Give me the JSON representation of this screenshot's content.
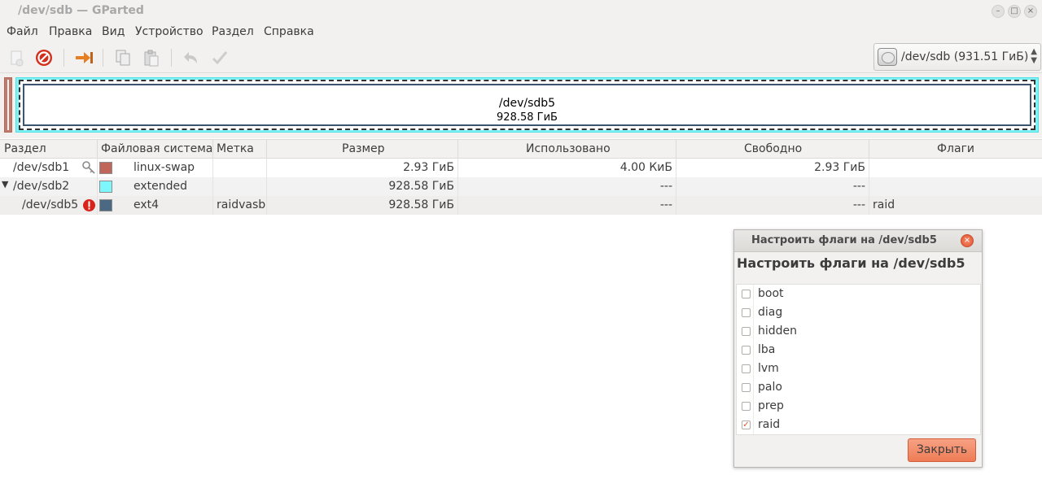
{
  "window": {
    "title": "/dev/sdb — GParted"
  },
  "menu": [
    "Файл",
    "Правка",
    "Вид",
    "Устройство",
    "Раздел",
    "Справка"
  ],
  "toolbar": {
    "icons": [
      "new-icon",
      "delete-icon",
      "resize-move-icon",
      "copy-icon",
      "paste-icon",
      "undo-icon",
      "apply-icon"
    ]
  },
  "device_selector": {
    "label": "/dev/sdb  (931.51 ГиБ)"
  },
  "disk_graph": {
    "name": "/dev/sdb5",
    "size": "928.58 ГиБ"
  },
  "colors": {
    "linux_swap": "#c1665a",
    "extended": "#7df7fc",
    "ext4": "#4b6983",
    "accent": "#ef7c55"
  },
  "table": {
    "headers": [
      "Раздел",
      "Файловая система",
      "Метка",
      "Размер",
      "Использовано",
      "Свободно",
      "Флаги"
    ],
    "rows": [
      {
        "partition": "/dev/sdb1",
        "filesystem": "linux-swap",
        "label": "",
        "size": "2.93 ГиБ",
        "used": "4.00 КиБ",
        "free": "2.93 ГиБ",
        "flags": ""
      },
      {
        "partition": "/dev/sdb2",
        "filesystem": "extended",
        "label": "",
        "size": "928.58 ГиБ",
        "used": "---",
        "free": "---",
        "flags": ""
      },
      {
        "partition": "/dev/sdb5",
        "filesystem": "ext4",
        "label": "raidvasb",
        "size": "928.58 ГиБ",
        "used": "---",
        "free": "---",
        "flags": "raid"
      }
    ]
  },
  "dialog": {
    "title": "Настроить флаги на /dev/sdb5",
    "heading": "Настроить флаги на /dev/sdb5",
    "flags": [
      {
        "name": "boot",
        "checked": false
      },
      {
        "name": "diag",
        "checked": false
      },
      {
        "name": "hidden",
        "checked": false
      },
      {
        "name": "lba",
        "checked": false
      },
      {
        "name": "lvm",
        "checked": false
      },
      {
        "name": "palo",
        "checked": false
      },
      {
        "name": "prep",
        "checked": false
      },
      {
        "name": "raid",
        "checked": true
      }
    ],
    "close_button": "Закрыть"
  }
}
